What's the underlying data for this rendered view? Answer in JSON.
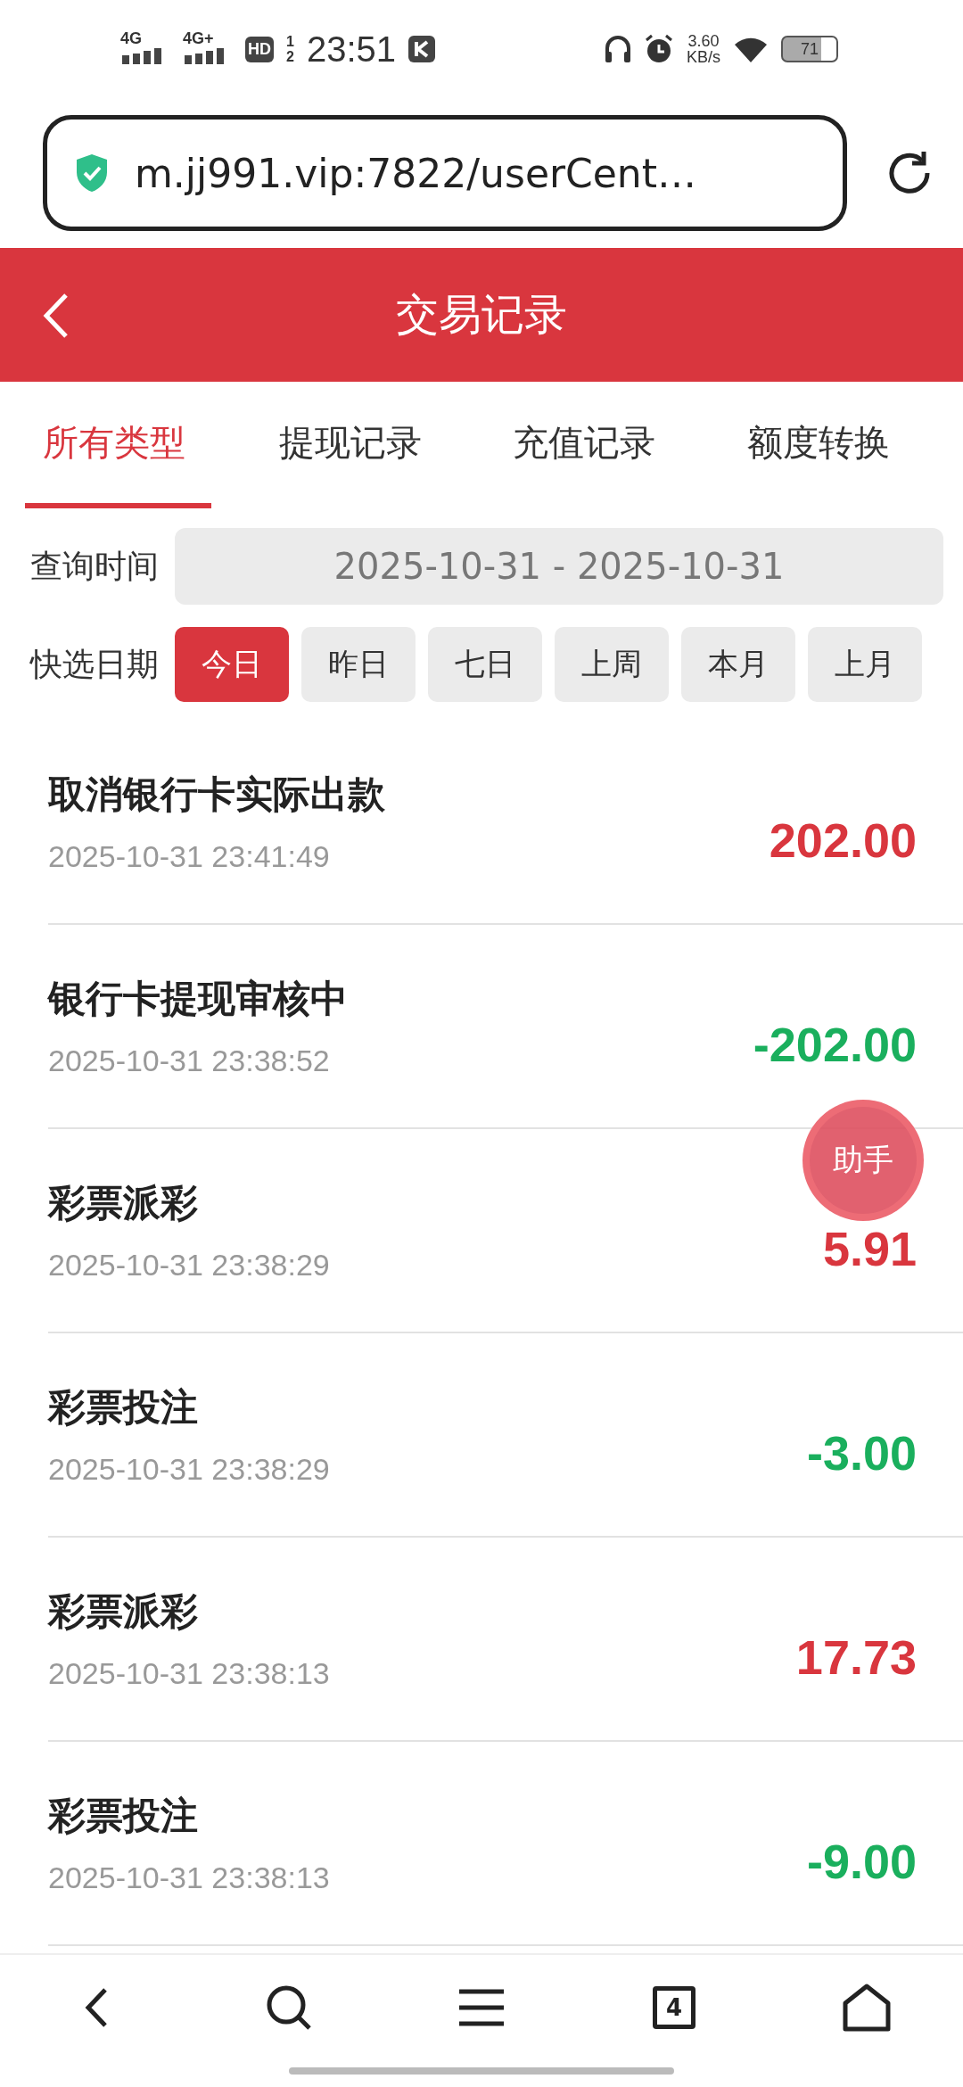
{
  "status_bar": {
    "signals": [
      "4G",
      "4G+"
    ],
    "hd": "HD",
    "hd_sims": [
      "1",
      "2"
    ],
    "time": "23:51",
    "speed": "3.60",
    "speed_unit": "KB/s",
    "battery": "71"
  },
  "browser": {
    "url": "m.jj991.vip:7822/userCent…",
    "tab_count": "4"
  },
  "header": {
    "title": "交易记录"
  },
  "tabs": [
    {
      "label": "所有类型",
      "selected": true
    },
    {
      "label": "提现记录",
      "selected": false
    },
    {
      "label": "充值记录",
      "selected": false
    },
    {
      "label": "额度转换",
      "selected": false
    }
  ],
  "query": {
    "label": "查询时间",
    "value": "2025-10-31 - 2025-10-31"
  },
  "quick": {
    "label": "快选日期",
    "options": [
      {
        "label": "今日",
        "selected": true
      },
      {
        "label": "昨日",
        "selected": false
      },
      {
        "label": "七日",
        "selected": false
      },
      {
        "label": "上周",
        "selected": false
      },
      {
        "label": "本月",
        "selected": false
      },
      {
        "label": "上月",
        "selected": false
      }
    ]
  },
  "records": [
    {
      "title": "取消银行卡实际出款",
      "time": "2025-10-31 23:41:49",
      "amount": "202.00",
      "kind": "income"
    },
    {
      "title": "银行卡提现审核中",
      "time": "2025-10-31 23:38:52",
      "amount": "-202.00",
      "kind": "expense"
    },
    {
      "title": "彩票派彩",
      "time": "2025-10-31 23:38:29",
      "amount": "5.91",
      "kind": "income"
    },
    {
      "title": "彩票投注",
      "time": "2025-10-31 23:38:29",
      "amount": "-3.00",
      "kind": "expense"
    },
    {
      "title": "彩票派彩",
      "time": "2025-10-31 23:38:13",
      "amount": "17.73",
      "kind": "income"
    },
    {
      "title": "彩票投注",
      "time": "2025-10-31 23:38:13",
      "amount": "-9.00",
      "kind": "expense"
    }
  ],
  "assistant": {
    "label": "助手"
  }
}
